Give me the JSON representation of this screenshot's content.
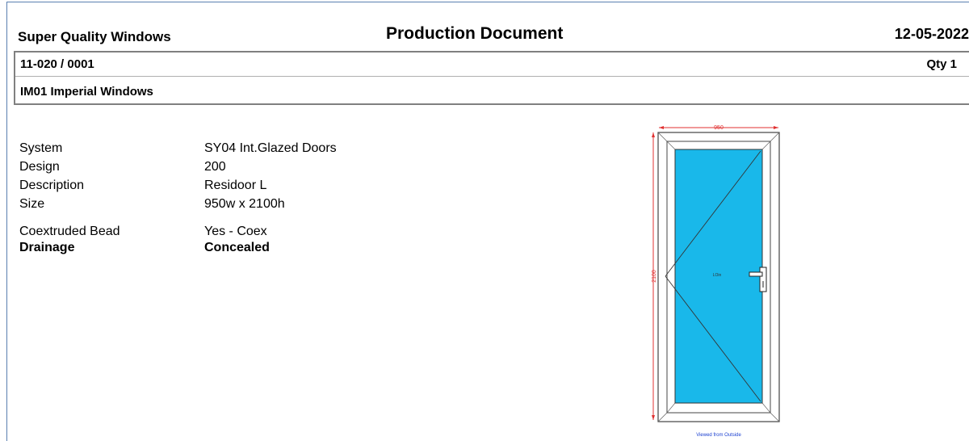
{
  "header": {
    "company": "Super Quality Windows",
    "title": "Production Document",
    "date": "12-05-2022"
  },
  "job": {
    "number": "11-020 / 0001",
    "qty": "Qty 1",
    "product": "IM01 Imperial Windows"
  },
  "specs": [
    {
      "label": "System",
      "value": "SY04  Int.Glazed Doors",
      "bold": false
    },
    {
      "label": "Design",
      "value": "200",
      "bold": false
    },
    {
      "label": "Description",
      "value": "Residoor L",
      "bold": false
    },
    {
      "label": "Size",
      "value": "950w x 2100h",
      "bold": false
    },
    {
      "label": "Coextruded Bead",
      "value": "Yes - Coex",
      "bold": false
    },
    {
      "label": "Drainage",
      "value": "Concealed",
      "bold": true
    }
  ],
  "drawing": {
    "width_dim": "950",
    "height_dim": "2100",
    "glass_label": "LOin",
    "view_note": "Viewed from Outside",
    "glass_color": "#19b8ea",
    "dimension_color": "#e03030",
    "note_color": "#1a3fd0"
  }
}
